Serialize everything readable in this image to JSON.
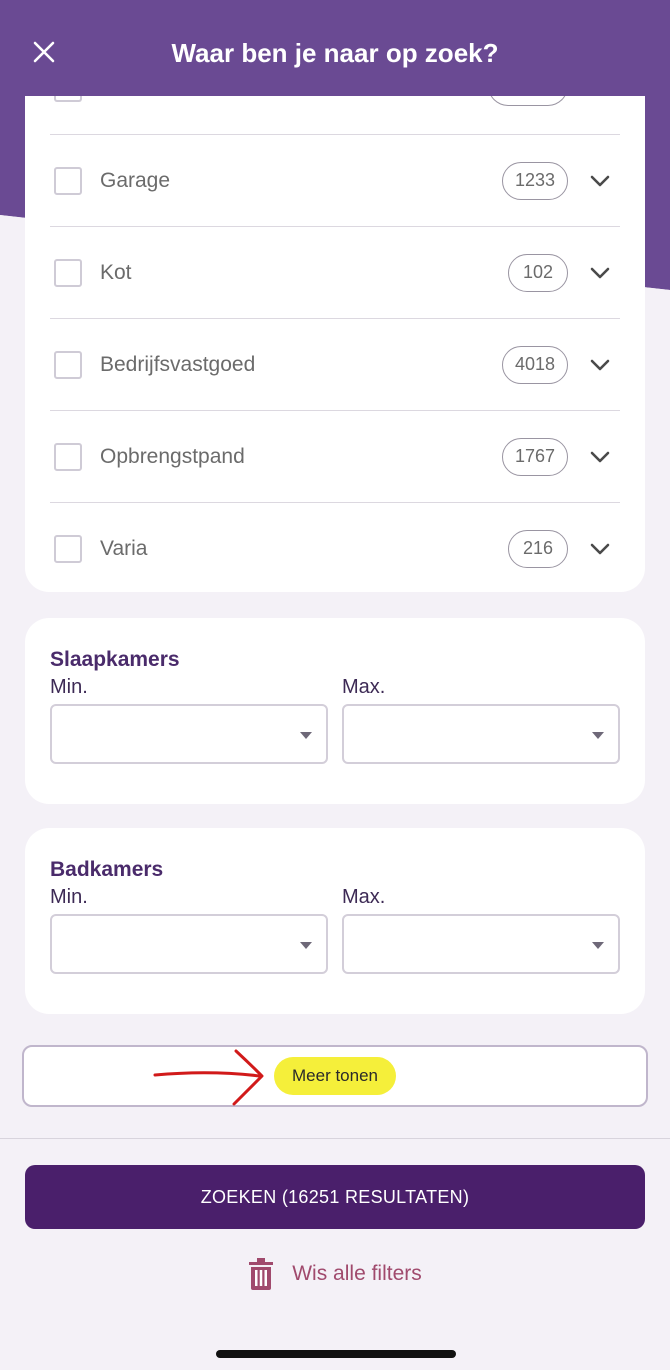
{
  "header": {
    "title": "Waar ben je naar op zoek?",
    "close_icon": "close-icon"
  },
  "property_types": [
    {
      "label": "Garage",
      "count": "1233"
    },
    {
      "label": "Kot",
      "count": "102"
    },
    {
      "label": "Bedrijfsvastgoed",
      "count": "4018"
    },
    {
      "label": "Opbrengstpand",
      "count": "1767"
    },
    {
      "label": "Varia",
      "count": "216"
    }
  ],
  "bedrooms": {
    "title": "Slaapkamers",
    "min_label": "Min.",
    "max_label": "Max."
  },
  "bathrooms": {
    "title": "Badkamers",
    "min_label": "Min.",
    "max_label": "Max."
  },
  "more": {
    "label": "Meer tonen"
  },
  "actions": {
    "search_label": "ZOEKEN (16251 RESULTATEN)",
    "clear_label": "Wis alle filters"
  },
  "colors": {
    "brand_purple": "#6a4a93",
    "button_purple": "#4a1f6b",
    "clear_pink": "#a04a6d",
    "highlight_yellow": "#f5ef3a",
    "annotation_red": "#d11a1a"
  }
}
